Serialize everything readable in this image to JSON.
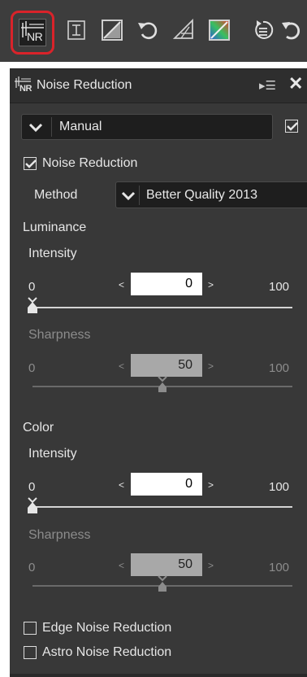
{
  "toolbar": {
    "buttons": [
      {
        "name": "noise-reduction-tool",
        "label": "NR",
        "active": true
      },
      {
        "name": "straighten-tool",
        "active": false
      },
      {
        "name": "levels-curves-tool",
        "active": false
      },
      {
        "name": "rotate-tool",
        "active": false
      },
      {
        "name": "perspective-tool",
        "active": false
      },
      {
        "name": "color-tool",
        "active": false
      },
      {
        "name": "history-tool",
        "active": false
      },
      {
        "name": "undo-tool",
        "active": false
      }
    ]
  },
  "panel": {
    "icon_label": "NR",
    "title": "Noise Reduction",
    "menu_icon": "▸☰",
    "close_icon": "✕",
    "preset": {
      "value": "Manual",
      "checked": true
    },
    "noise_reduction": {
      "label": "Noise Reduction",
      "checked": true
    },
    "method": {
      "label": "Method",
      "value": "Better Quality 2013"
    },
    "luminance": {
      "label": "Luminance",
      "intensity": {
        "label": "Intensity",
        "value": "0",
        "min": "0",
        "max": "100",
        "level": 0
      },
      "sharpness": {
        "label": "Sharpness",
        "value": "50",
        "min": "0",
        "max": "100",
        "level": 50,
        "enabled": false
      }
    },
    "color": {
      "label": "Color",
      "intensity": {
        "label": "Intensity",
        "value": "0",
        "min": "0",
        "max": "100",
        "level": 0
      },
      "sharpness": {
        "label": "Sharpness",
        "value": "50",
        "min": "0",
        "max": "100",
        "level": 50,
        "enabled": false
      }
    },
    "edge_nr": {
      "label": "Edge Noise Reduction",
      "checked": false
    },
    "astro_nr": {
      "label": "Astro Noise Reduction",
      "checked": false
    }
  },
  "colors": {
    "toolbar_bg": "#3d3d3d",
    "panel_bg": "#383838",
    "active_outline": "#d9232a"
  }
}
